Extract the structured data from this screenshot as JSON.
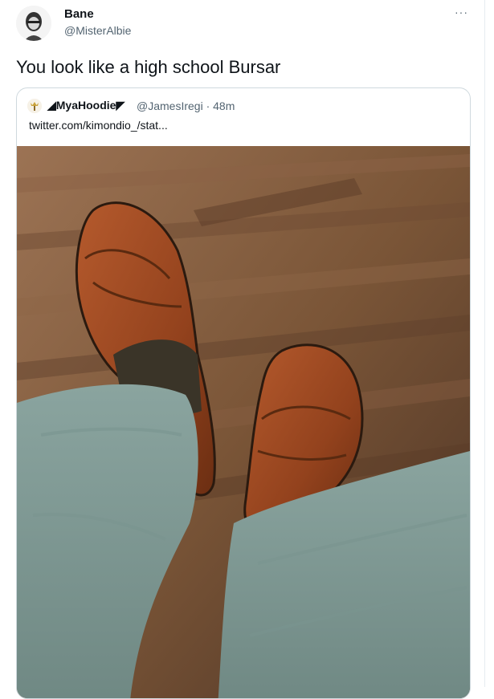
{
  "author": {
    "name": "Bane",
    "handle": "@MisterAlbie"
  },
  "more_menu": "···",
  "tweet_text": "You look like a high school Bursar",
  "quoted": {
    "name": "◢MyaHoodie◤",
    "handle_time": "@JamesIregi · 48m",
    "link_text": "twitter.com/kimondio_/stat..."
  },
  "colors": {
    "text_primary": "#0f1419",
    "text_secondary": "#536471",
    "border": "#cfd9de"
  },
  "icons": {
    "more": "more-dots-icon",
    "quoted_avatar": "crown-avatar-icon"
  }
}
